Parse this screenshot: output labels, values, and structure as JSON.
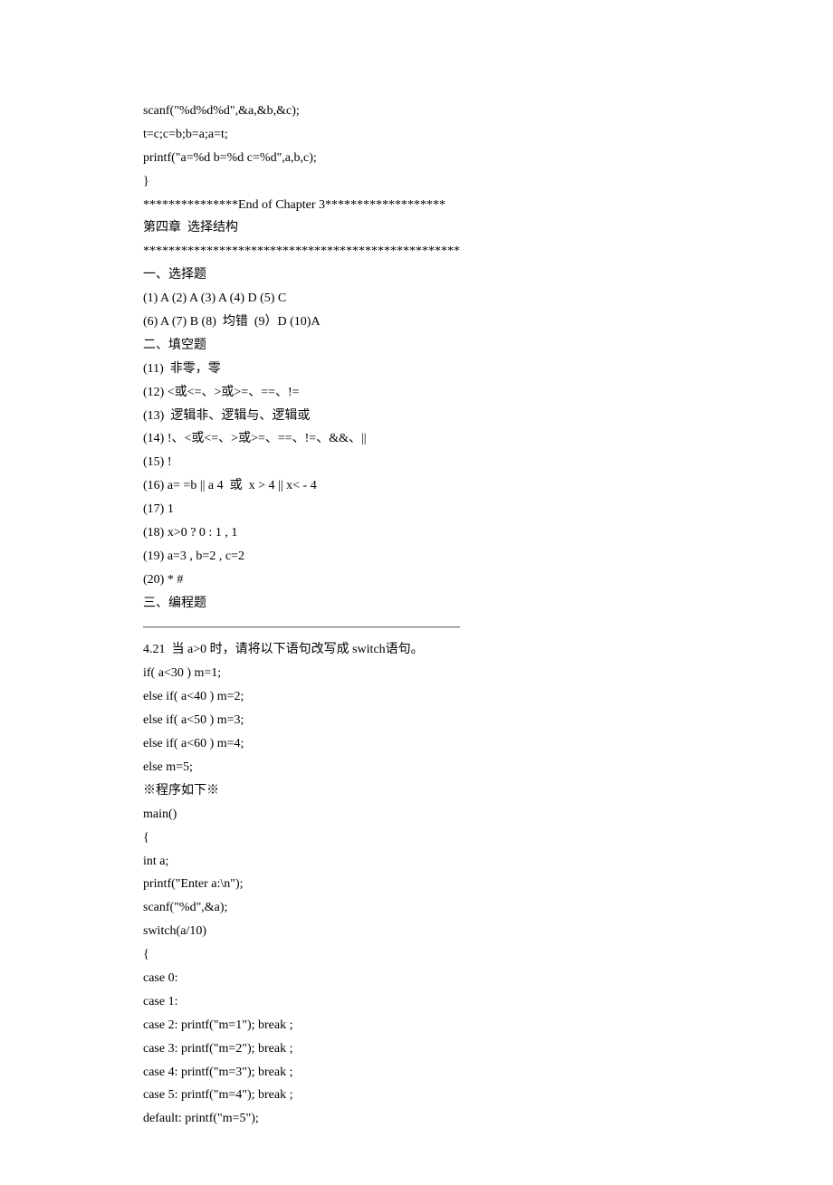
{
  "lines": [
    "scanf(\"%d%d%d\",&a,&b,&c);",
    "t=c;c=b;b=a;a=t;",
    "printf(\"a=%d b=%d c=%d\",a,b,c);",
    "}",
    "***************End of Chapter 3*******************",
    "第四章  选择结构",
    "**************************************************",
    "一、选择题",
    "(1) A (2) A (3) A (4) D (5) C",
    "(6) A (7) B (8)  均错  (9）D (10)A",
    "二、填空题",
    "(11)  非零，零",
    "(12) <或<=、>或>=、==、!=",
    "(13)  逻辑非、逻辑与、逻辑或",
    "(14) !、<或<=、>或>=、==、!=、&&、||",
    "(15) !",
    "(16) a= =b || a 4  或  x > 4 || x< - 4",
    "(17) 1",
    "(18) x>0 ? 0 : 1 , 1",
    "(19) a=3 , b=2 , c=2",
    "(20) * #",
    "三、编程题",
    "—————————————————————————",
    "4.21  当 a>0 时，请将以下语句改写成 switch语句。",
    "if( a<30 ) m=1;",
    "else if( a<40 ) m=2;",
    "else if( a<50 ) m=3;",
    "else if( a<60 ) m=4;",
    "else m=5;",
    "※程序如下※",
    "main()",
    "{",
    "int a;",
    "printf(\"Enter a:\\n\");",
    "scanf(\"%d\",&a);",
    "switch(a/10)",
    "{",
    "case 0:",
    "case 1:",
    "case 2: printf(\"m=1\"); break ;",
    "case 3: printf(\"m=2\"); break ;",
    "case 4: printf(\"m=3\"); break ;",
    "case 5: printf(\"m=4\"); break ;",
    "default: printf(\"m=5\");"
  ]
}
